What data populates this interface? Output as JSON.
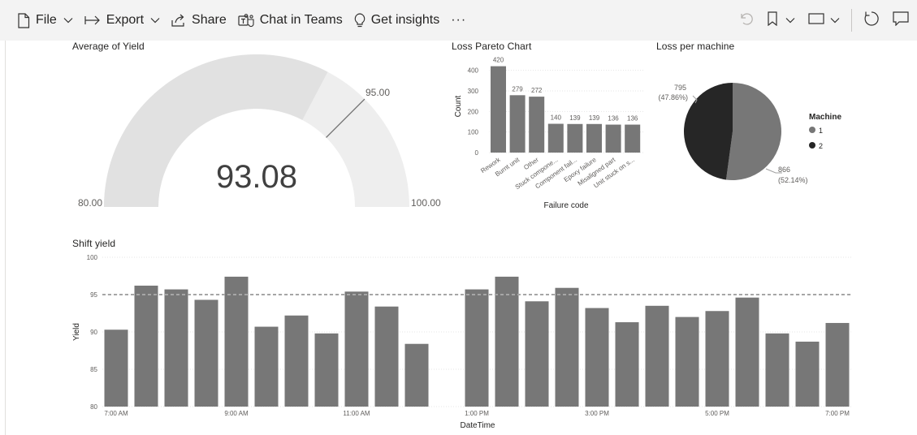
{
  "toolbar": {
    "file_label": "File",
    "export_label": "Export",
    "share_label": "Share",
    "teams_label": "Chat in Teams",
    "insights_label": "Get insights",
    "more_label": "···"
  },
  "colors": {
    "toolbar_bg": "#f3f3f3",
    "bar": "#777777",
    "gauge_fill": "#e1e1e1",
    "gauge_rest": "#eeeeee",
    "pie_machine_1": "#777777",
    "pie_machine_2": "#262626",
    "target_line": "#a6a6a6"
  },
  "gauge": {
    "title": "Average of Yield",
    "value_label": "93.08",
    "min_label": "80.00",
    "max_label": "100.00",
    "target_label": "95.00",
    "chart_data": {
      "type": "gauge",
      "value": 93.08,
      "min": 80,
      "max": 100,
      "target": 95
    }
  },
  "pareto": {
    "title": "Loss Pareto Chart",
    "xlabel": "Failure code",
    "ylabel": "Count",
    "chart_data": {
      "type": "bar",
      "categories": [
        "Rework",
        "Burnt unit",
        "Other",
        "Stuck compone...",
        "Component fail...",
        "Epoxy failure",
        "Misaligned part",
        "Unit stuck on s..."
      ],
      "values": [
        420,
        279,
        272,
        140,
        139,
        139,
        136,
        136
      ],
      "data_labels": [
        "420",
        "279",
        "272",
        "140",
        "139",
        "139",
        "136",
        "136"
      ],
      "ylim": [
        0,
        450
      ],
      "yticks": [
        0,
        100,
        200,
        300,
        400
      ],
      "ytick_labels": [
        "0",
        "100",
        "200",
        "300",
        "400"
      ],
      "grid": true
    }
  },
  "pie": {
    "title": "Loss per machine",
    "legend_title": "Machine",
    "chart_data": {
      "type": "pie",
      "slices": [
        {
          "label": "1",
          "value": 866,
          "value_label": "866",
          "pct_label": "(52.14%)",
          "color": "#777777"
        },
        {
          "label": "2",
          "value": 795,
          "value_label": "795",
          "pct_label": "(47.86%)",
          "color": "#262626"
        }
      ],
      "legend_placement": "right"
    }
  },
  "shift": {
    "title": "Shift yield",
    "xlabel": "DateTime",
    "ylabel": "Yield",
    "chart_data": {
      "type": "bar",
      "x_hours": [
        7,
        7.5,
        8,
        8.5,
        9,
        9.5,
        10,
        10.5,
        11,
        11.5,
        12,
        13,
        13.5,
        14,
        14.5,
        15,
        15.5,
        16,
        16.5,
        17,
        17.5,
        18,
        18.5,
        19
      ],
      "values": [
        90.3,
        96.2,
        95.7,
        94.3,
        97.4,
        90.7,
        92.2,
        89.8,
        95.4,
        93.4,
        88.4,
        95.7,
        97.4,
        94.1,
        95.9,
        93.2,
        91.3,
        93.5,
        92.0,
        92.8,
        94.6,
        89.8,
        88.7,
        91.2
      ],
      "ylim": [
        80,
        100
      ],
      "yticks": [
        80,
        85,
        90,
        95,
        100
      ],
      "ytick_labels": [
        "80",
        "85",
        "90",
        "95",
        "100"
      ],
      "xtick_hours": [
        7,
        9,
        11,
        13,
        15,
        17,
        19
      ],
      "xtick_labels": [
        "7:00 AM",
        "9:00 AM",
        "11:00 AM",
        "1:00 PM",
        "3:00 PM",
        "5:00 PM",
        "7:00 PM"
      ],
      "target": 95,
      "grid": true
    }
  }
}
